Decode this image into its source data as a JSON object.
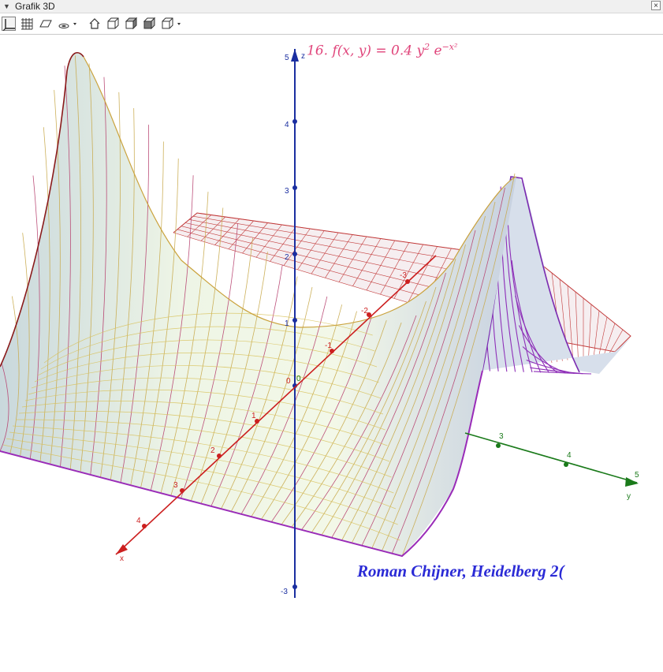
{
  "window": {
    "title": "Grafik 3D",
    "close_symbol": "×"
  },
  "toolbar": {
    "buttons": [
      "axes-toggle",
      "grid-toggle",
      "plane-toggle",
      "projection-menu",
      "home-view",
      "view-front",
      "view-side",
      "view-top",
      "view-rotate-menu"
    ]
  },
  "graph": {
    "title_main": "16. f(x, y) = 0.4 y",
    "title_exp1": "2",
    "title_e": " e",
    "title_exp2": "−x²",
    "credit": "Roman Chijner, Heidelberg 2(",
    "z_axis": {
      "name": "z",
      "ticks": [
        "5",
        "4",
        "3",
        "2",
        "1",
        "-3"
      ]
    },
    "x_axis": {
      "name": "x",
      "ticks": [
        "-3",
        "-2",
        "-1",
        "0",
        "1",
        "2",
        "3",
        "4"
      ]
    },
    "y_axis": {
      "name": "y",
      "ticks": [
        "0",
        "3",
        "4",
        "5"
      ]
    },
    "colors": {
      "z_axis": "#1a2ea0",
      "x_axis": "#cc1f1f",
      "y_axis": "#1a7a1a",
      "title": "#e0457b",
      "credit": "#2b2bd6"
    }
  }
}
